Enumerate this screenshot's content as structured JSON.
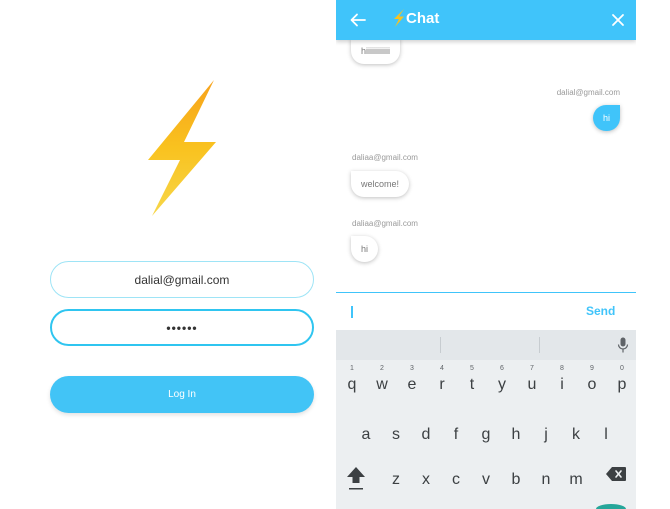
{
  "login": {
    "email_value": "dalial@gmail.com",
    "password_value": "••••••",
    "login_label": "Log In"
  },
  "chat": {
    "title": "Chat",
    "messages": [
      {
        "sender": "",
        "text": "hiiiiiiiiiiii"
      },
      {
        "sender": "dalial@gmail.com",
        "text": "hi"
      },
      {
        "sender": "daliaa@gmail.com",
        "text": "welcome!"
      },
      {
        "sender": "daliaa@gmail.com",
        "text": "hi"
      }
    ],
    "input_value": "",
    "send_label": "Send"
  },
  "keyboard": {
    "row1": [
      {
        "key": "q",
        "hint": "1"
      },
      {
        "key": "w",
        "hint": "2"
      },
      {
        "key": "e",
        "hint": "3"
      },
      {
        "key": "r",
        "hint": "4"
      },
      {
        "key": "t",
        "hint": "5"
      },
      {
        "key": "y",
        "hint": "6"
      },
      {
        "key": "u",
        "hint": "7"
      },
      {
        "key": "i",
        "hint": "8"
      },
      {
        "key": "o",
        "hint": "9"
      },
      {
        "key": "p",
        "hint": "0"
      }
    ],
    "row2": [
      "a",
      "s",
      "d",
      "f",
      "g",
      "h",
      "j",
      "k",
      "l"
    ],
    "row3": [
      "z",
      "x",
      "c",
      "v",
      "b",
      "n",
      "m"
    ]
  },
  "colors": {
    "accent": "#40c4fa",
    "bolt_top": "#f9c623",
    "bolt_bottom": "#f5a623"
  },
  "icons": {
    "logo": "lightning-bolt-icon",
    "back": "arrow-left-icon",
    "close": "close-icon",
    "mic": "microphone-icon",
    "shift": "shift-icon",
    "backspace": "backspace-icon"
  }
}
